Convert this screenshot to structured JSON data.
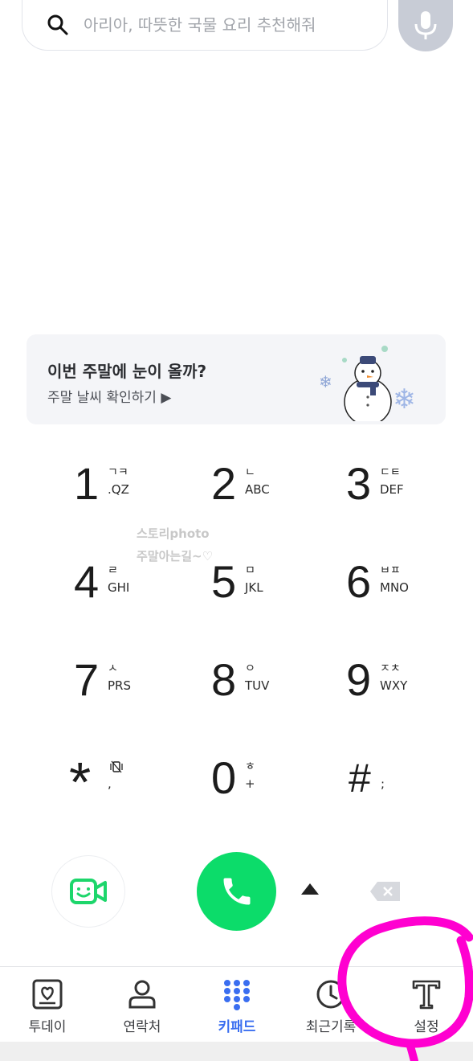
{
  "search": {
    "placeholder": "아리아, 따뜻한 국물 요리 추천해줘"
  },
  "banner": {
    "title": "이번 주말에 눈이 올까?",
    "subtitle": "주말 날씨 확인하기 ▶"
  },
  "watermark": {
    "line1": "스토리photo",
    "line2": "주말아는길~♡"
  },
  "keypad": [
    {
      "digit": "1",
      "hangul": "ㄱㅋ",
      "letters": ".QZ"
    },
    {
      "digit": "2",
      "hangul": "ㄴ",
      "letters": "ABC"
    },
    {
      "digit": "3",
      "hangul": "ㄷㅌ",
      "letters": "DEF"
    },
    {
      "digit": "4",
      "hangul": "ㄹ",
      "letters": "GHI"
    },
    {
      "digit": "5",
      "hangul": "ㅁ",
      "letters": "JKL"
    },
    {
      "digit": "6",
      "hangul": "ㅂㅍ",
      "letters": "MNO"
    },
    {
      "digit": "7",
      "hangul": "ㅅ",
      "letters": "PRS"
    },
    {
      "digit": "8",
      "hangul": "ㅇ",
      "letters": "TUV"
    },
    {
      "digit": "9",
      "hangul": "ㅈㅊ",
      "letters": "WXY"
    },
    {
      "digit": "*",
      "hangul": "",
      "letters": ","
    },
    {
      "digit": "0",
      "hangul": "ㅎ",
      "letters": "+"
    },
    {
      "digit": "#",
      "hangul": "",
      "letters": ";"
    }
  ],
  "nav": {
    "items": [
      {
        "label": "투데이",
        "icon": "today-icon"
      },
      {
        "label": "연락처",
        "icon": "contacts-icon"
      },
      {
        "label": "키패드",
        "icon": "keypad-icon",
        "active": true
      },
      {
        "label": "최근기록",
        "icon": "recent-icon"
      },
      {
        "label": "설정",
        "icon": "settings-t-icon"
      }
    ]
  },
  "colors": {
    "call_green": "#0cdc6a",
    "active_blue": "#3a6ef0",
    "video_green": "#1dd66b",
    "highlight_magenta": "#ff00d0"
  }
}
